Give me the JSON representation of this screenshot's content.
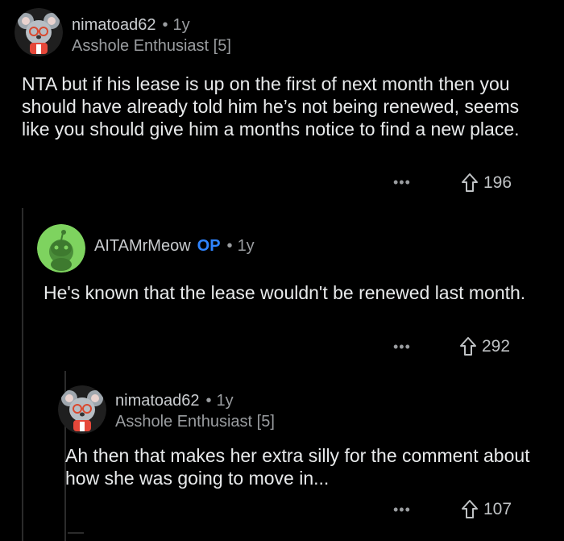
{
  "comments": [
    {
      "username": "nimatoad62",
      "age": "1y",
      "flair": "Asshole Enthusiast [5]",
      "body": "NTA but if his lease is up on the first of next month then you should have already told him he’s not being renewed, seems like you should give him a months notice to find a new place.",
      "more": "•••",
      "upvotes": "196"
    },
    {
      "username": "AITAMrMeow",
      "op_badge": "OP",
      "age": "1y",
      "body": "He's  known that the lease wouldn't be renewed last month.",
      "more": "•••",
      "upvotes": "292"
    },
    {
      "username": "nimatoad62",
      "age": "1y",
      "flair": "Asshole Enthusiast [5]",
      "body": "Ah then that makes her extra silly for the comment about how she was going to move in...",
      "more": "•••",
      "upvotes": "107"
    }
  ],
  "colors": {
    "background": "#000000",
    "op_badge": "#2f84ff",
    "reddit_avatar_bg": "#7ed35f"
  },
  "icons": {
    "avatar_1": "koala-avatar-icon",
    "avatar_2": "default-snoo-avatar-icon",
    "upvote": "upvote-arrow-icon",
    "more": "more-options-icon"
  }
}
